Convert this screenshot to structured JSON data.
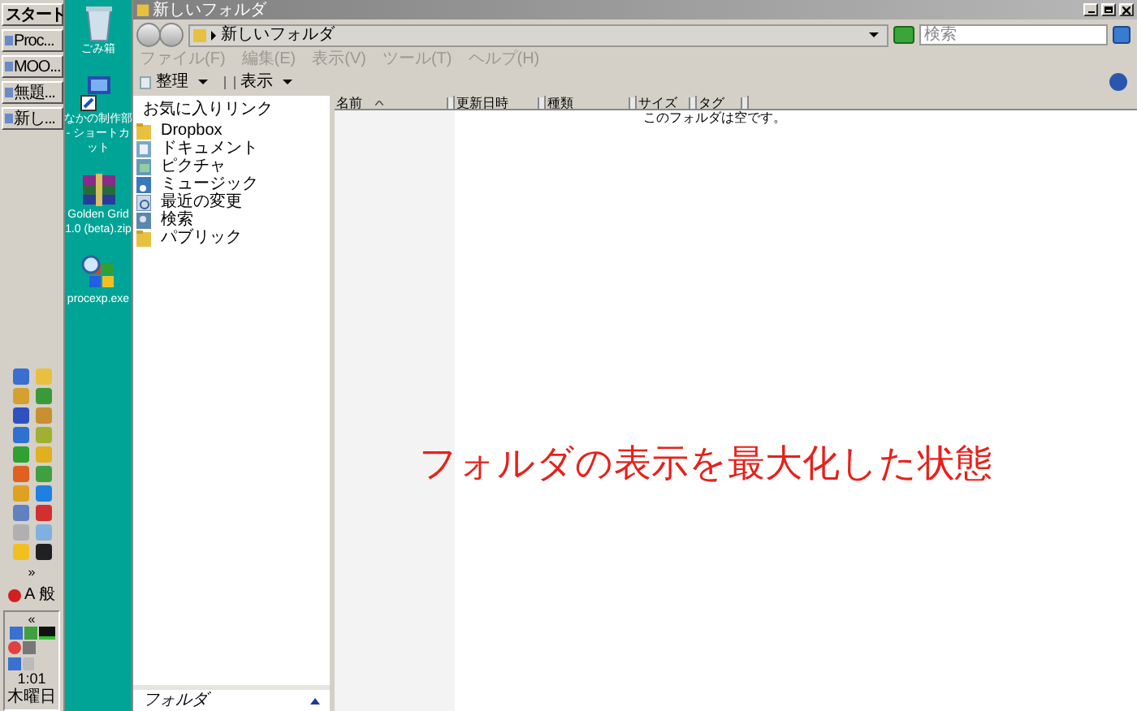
{
  "taskbar": {
    "start": "スタート",
    "buttons": [
      {
        "label": "Proc..."
      },
      {
        "label": "MOO..."
      },
      {
        "label": "無題..."
      },
      {
        "label": "新し..."
      }
    ],
    "tray_more": "»",
    "ime": "A 般",
    "tray_collapse": "«",
    "clock": "1:01",
    "day": "木曜日"
  },
  "desktop_icons": [
    {
      "kind": "trash",
      "label": "ごみ箱"
    },
    {
      "kind": "shortcut",
      "label": "なかの制作部 - ショートカット"
    },
    {
      "kind": "archive",
      "label": "Golden Grid 1.0 (beta).zip"
    },
    {
      "kind": "program",
      "label": "procexp.exe"
    }
  ],
  "window": {
    "title": "新しいフォルダ",
    "address": "新しいフォルダ",
    "search": {
      "placeholder": "検索"
    },
    "menu": [
      {
        "label": "ファイル(F)",
        "disabled": true
      },
      {
        "label": "編集(E)",
        "disabled": true
      },
      {
        "label": "表示(V)",
        "disabled": true
      },
      {
        "label": "ツール(T)",
        "disabled": true
      },
      {
        "label": "ヘルプ(H)",
        "disabled": true
      }
    ],
    "toolbar": [
      {
        "kind": "organize",
        "label": "整理"
      },
      {
        "kind": "views",
        "label": "表示"
      }
    ],
    "favorites": {
      "title": "お気に入りリンク",
      "items": [
        {
          "kind": "folder",
          "label": "Dropbox"
        },
        {
          "kind": "documents",
          "label": "ドキュメント"
        },
        {
          "kind": "pictures",
          "label": "ピクチャ"
        },
        {
          "kind": "music",
          "label": "ミュージック"
        },
        {
          "kind": "recent",
          "label": "最近の変更"
        },
        {
          "kind": "search",
          "label": "検索"
        },
        {
          "kind": "folder",
          "label": "パブリック"
        }
      ]
    },
    "folders_pane": {
      "label": "フォルダ"
    },
    "columns": [
      {
        "label": "名前",
        "sorted": true
      },
      {
        "label": "更新日時",
        "sorted": false
      },
      {
        "label": "種類",
        "sorted": false
      },
      {
        "label": "サイズ",
        "sorted": false
      },
      {
        "label": "タグ",
        "sorted": false
      }
    ],
    "empty_message": "このフォルダは空です。"
  },
  "annotation": "フォルダの表示を最大化した状態"
}
